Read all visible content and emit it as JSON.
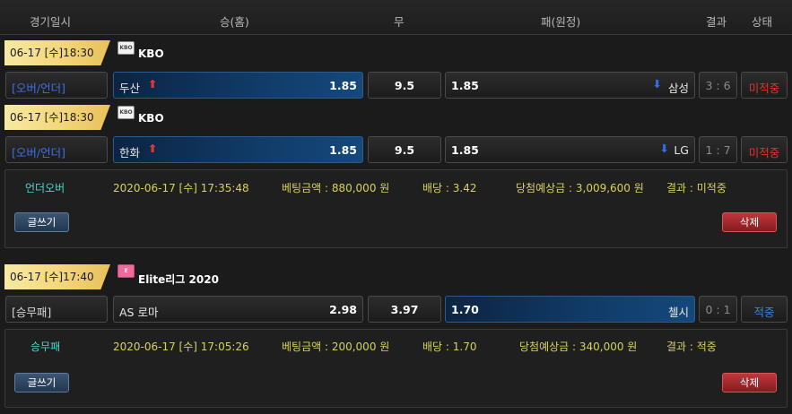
{
  "header": {
    "date": "경기일시",
    "home": "승(홈)",
    "draw": "무",
    "away": "패(원정)",
    "result": "결과",
    "status": "상태"
  },
  "bets": [
    {
      "games": [
        {
          "datetime": "06-17 [수]18:30",
          "league": "KBO",
          "type": "[오버/언더]",
          "home_team": "두산",
          "home_odds": "1.85",
          "draw_value": "9.5",
          "away_odds": "1.85",
          "away_team": "삼성",
          "score": "3 : 6",
          "status": "미적중"
        },
        {
          "datetime": "06-17 [수]18:30",
          "league": "KBO",
          "type": "[오버/언더]",
          "home_team": "한화",
          "home_odds": "1.85",
          "draw_value": "9.5",
          "away_odds": "1.85",
          "away_team": "LG",
          "score": "1 : 7",
          "status": "미적중"
        }
      ],
      "summary": {
        "type": "언더오버",
        "datetime": "2020-06-17 [수] 17:35:48",
        "amount": "베팅금액 : 880,000 원",
        "odds": "배당 : 3.42",
        "expected": "당첨예상금 : 3,009,600 원",
        "result": "결과 : 미적중"
      },
      "write_label": "글쓰기",
      "delete_label": "삭제"
    },
    {
      "games": [
        {
          "datetime": "06-17 [수]17:40",
          "league": "Elite리그 2020",
          "type": "[승무패]",
          "home_team": "AS 로마",
          "home_odds": "2.98",
          "draw_value": "3.97",
          "away_odds": "1.70",
          "away_team": "첼시",
          "score": "0 : 1",
          "status": "적중"
        }
      ],
      "summary": {
        "type": "승무패",
        "datetime": "2020-06-17 [수] 17:05:26",
        "amount": "베팅금액 : 200,000 원",
        "odds": "배당 : 1.70",
        "expected": "당첨예상금 : 340,000 원",
        "result": "결과 : 적중"
      },
      "write_label": "글쓰기",
      "delete_label": "삭제"
    }
  ],
  "icons": {
    "league_kbo": "kbo-logo-icon",
    "league_elite": "elite-league-logo-icon",
    "home_arrow": "arrow-up-icon",
    "away_arrow": "arrow-down-icon"
  },
  "colors": {
    "selected_blue": "#113c69",
    "miss_red": "#e23030",
    "hit_blue": "#3d7fe6",
    "gold_tag": "#f3d67a",
    "info_yellow": "#d9d25a",
    "info_cyan": "#4ad6d0"
  }
}
